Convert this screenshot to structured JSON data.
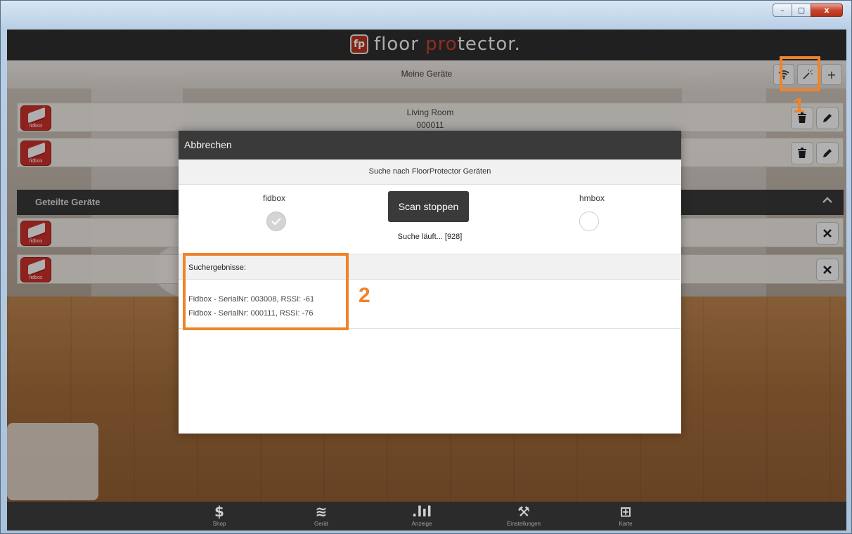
{
  "window": {
    "controls": {
      "minimize": "–",
      "maximize": "▢",
      "close": "x"
    }
  },
  "header": {
    "logo_badge": "fp",
    "logo_text_part1": "floor ",
    "logo_text_accent": "pro",
    "logo_text_part2": "tector.",
    "page_title": "Meine Geräte",
    "buttons": {
      "wifi": "wifi-icon",
      "scan": "magic-wand-icon",
      "add": "+"
    }
  },
  "devices": [
    {
      "name": "Living Room",
      "serial": "000011",
      "icon_label": "fidbox"
    },
    {
      "name": "",
      "serial": "",
      "icon_label": "fidbox"
    }
  ],
  "shared": {
    "title": "Geteilte Geräte",
    "devices": [
      {
        "icon_label": "fidbox"
      },
      {
        "icon_label": "fidbox"
      }
    ]
  },
  "modal": {
    "cancel": "Abbrechen",
    "subtitle": "Suche nach FloorProtector Geräten",
    "option_left": "fidbox",
    "option_right": "hmbox",
    "scan_button": "Scan stoppen",
    "status": "Suche läuft... [928]",
    "results_title": "Suchergebnisse:",
    "results": [
      "Fidbox - SerialNr: 003008, RSSI: -61",
      "Fidbox - SerialNr: 000111, RSSI: -76"
    ]
  },
  "annotations": {
    "one": "1",
    "two": "2"
  },
  "tabs": [
    {
      "label": "Shop",
      "icon": "$",
      "icon_name": "dollar-icon"
    },
    {
      "label": "Gerät",
      "icon": "≋",
      "icon_name": "layers-icon"
    },
    {
      "label": "Anzeige",
      "icon": ".lıl",
      "icon_name": "bar-chart-icon"
    },
    {
      "label": "Einstellungen",
      "icon": "⚒",
      "icon_name": "tools-icon"
    },
    {
      "label": "Karte",
      "icon": "⊞",
      "icon_name": "map-icon"
    }
  ],
  "colors": {
    "accent": "#f0832a",
    "brand": "#c4412b",
    "dark": "#2d2d2d"
  }
}
